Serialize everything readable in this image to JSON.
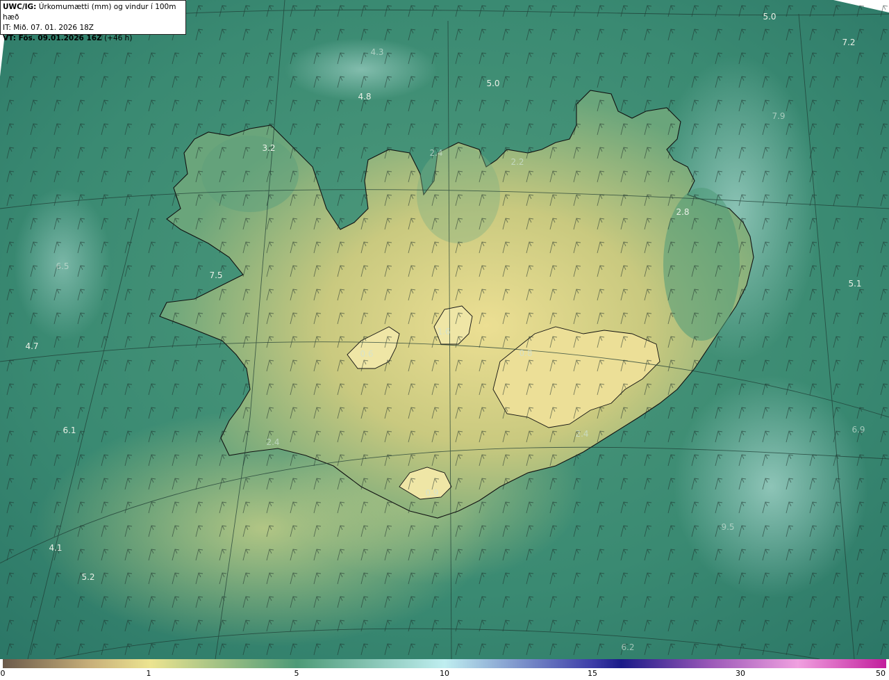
{
  "header": {
    "model": "UWC/IG:",
    "product": "Úrkomumætti (mm) og vindur í 100m hæð",
    "init_time": "IT: Mið. 07. 01. 2026 18Z",
    "valid_label": "VT: Fös. 09.01.2026 16Z",
    "lead": "(+46 h)"
  },
  "colors": {
    "sea_dark": "#2f7d6c",
    "sea_light": "#9ad6cc",
    "land_yellow": "#e3dc8f",
    "coast_line": "#111111"
  },
  "map_values": [
    {
      "id": "v1",
      "text": "5.0"
    },
    {
      "id": "v2",
      "text": "7.2"
    },
    {
      "id": "v3",
      "text": "4.3"
    },
    {
      "id": "v4",
      "text": "4.8"
    },
    {
      "id": "v5",
      "text": "5.0"
    },
    {
      "id": "v6",
      "text": "7.9"
    },
    {
      "id": "v7",
      "text": "3.2"
    },
    {
      "id": "v8",
      "text": "2.4"
    },
    {
      "id": "v9",
      "text": "2.2"
    },
    {
      "id": "v10",
      "text": "2.8"
    },
    {
      "id": "v11",
      "text": "6.5"
    },
    {
      "id": "v12",
      "text": "7.5"
    },
    {
      "id": "v13",
      "text": "5.1"
    },
    {
      "id": "v14",
      "text": "4.7"
    },
    {
      "id": "v15",
      "text": "0.6"
    },
    {
      "id": "v16",
      "text": "1.6"
    },
    {
      "id": "v17",
      "text": "0.8"
    },
    {
      "id": "v18",
      "text": "6.1"
    },
    {
      "id": "v19",
      "text": "2.4"
    },
    {
      "id": "v20",
      "text": "2.4"
    },
    {
      "id": "v21",
      "text": "6.9"
    },
    {
      "id": "v22",
      "text": "0.9"
    },
    {
      "id": "v23",
      "text": "4.1"
    },
    {
      "id": "v24",
      "text": "9.5"
    },
    {
      "id": "v25",
      "text": "5.2"
    },
    {
      "id": "v26",
      "text": "6.2"
    }
  ],
  "scale": {
    "ticks": [
      "0",
      "1",
      "5",
      "10",
      "15",
      "30",
      "50"
    ]
  }
}
